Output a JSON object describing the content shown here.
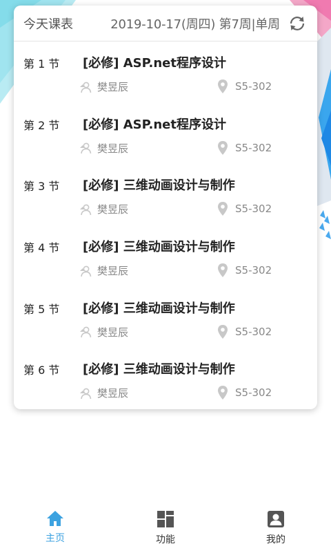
{
  "header": {
    "title": "今天课表",
    "date_info": "2019-10-17(周四) 第7周|单周",
    "refresh_icon": "refresh-icon"
  },
  "schedule": [
    {
      "period": "第 1 节",
      "course": "[必修] ASP.net程序设计",
      "teacher": "樊昱辰",
      "room": "S5-302"
    },
    {
      "period": "第 2 节",
      "course": "[必修] ASP.net程序设计",
      "teacher": "樊昱辰",
      "room": "S5-302"
    },
    {
      "period": "第 3 节",
      "course": "[必修] 三维动画设计与制作",
      "teacher": "樊昱辰",
      "room": "S5-302"
    },
    {
      "period": "第 4 节",
      "course": "[必修] 三维动画设计与制作",
      "teacher": "樊昱辰",
      "room": "S5-302"
    },
    {
      "period": "第 5 节",
      "course": "[必修] 三维动画设计与制作",
      "teacher": "樊昱辰",
      "room": "S5-302"
    },
    {
      "period": "第 6 节",
      "course": "[必修] 三维动画设计与制作",
      "teacher": "樊昱辰",
      "room": "S5-302"
    }
  ],
  "tabbar": {
    "items": [
      {
        "label": "主页",
        "icon": "home-icon",
        "active": true
      },
      {
        "label": "功能",
        "icon": "grid-icon",
        "active": false
      },
      {
        "label": "我的",
        "icon": "profile-icon",
        "active": false
      }
    ]
  },
  "colors": {
    "accent": "#3ca2e0",
    "text_primary": "#222222",
    "text_secondary": "#888888",
    "icon_gray": "#c8c8c8"
  }
}
